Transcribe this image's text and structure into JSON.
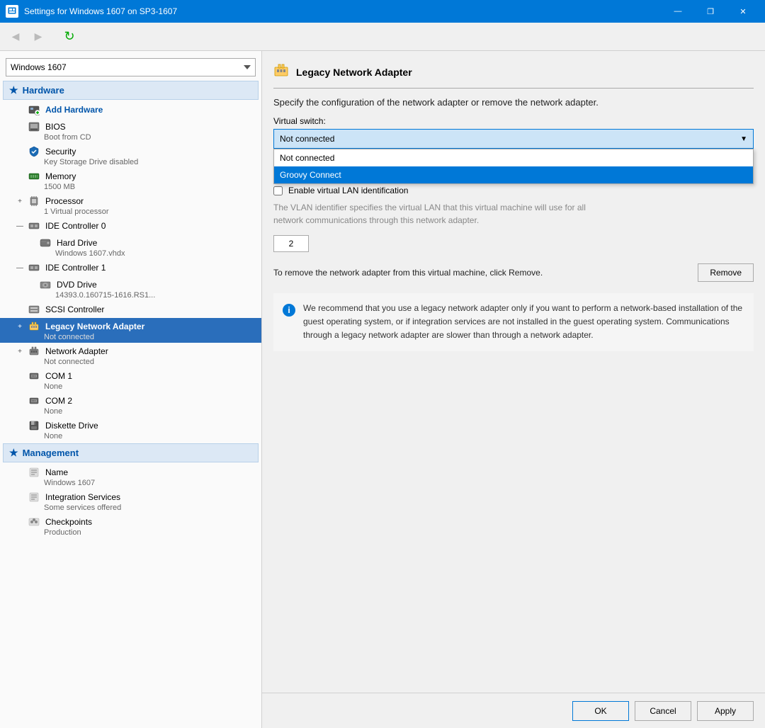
{
  "window": {
    "title": "Settings for Windows 1607 on SP3-1607",
    "icon": "⚙"
  },
  "titlebar": {
    "minimize": "—",
    "restore": "❐",
    "close": "✕"
  },
  "toolbar": {
    "back_label": "◀",
    "forward_label": "▶",
    "refresh_label": "↻"
  },
  "sidebar": {
    "dropdown_value": "Windows 1607",
    "sections": [
      {
        "id": "hardware",
        "label": "Hardware",
        "items": [
          {
            "id": "add-hardware",
            "name": "Add Hardware",
            "subtitle": "",
            "icon": "➕",
            "iconType": "add",
            "level": 1,
            "expandable": false
          },
          {
            "id": "bios",
            "name": "BIOS",
            "subtitle": "Boot from CD",
            "icon": "💾",
            "iconType": "bios",
            "level": 1,
            "expandable": false
          },
          {
            "id": "security",
            "name": "Security",
            "subtitle": "Key Storage Drive disabled",
            "icon": "🛡",
            "iconType": "security",
            "level": 1,
            "expandable": false
          },
          {
            "id": "memory",
            "name": "Memory",
            "subtitle": "1500 MB",
            "icon": "🔲",
            "iconType": "memory",
            "level": 1,
            "expandable": false
          },
          {
            "id": "processor",
            "name": "Processor",
            "subtitle": "1 Virtual processor",
            "icon": "🔲",
            "iconType": "processor",
            "level": 1,
            "expandable": true,
            "expanded": false
          },
          {
            "id": "ide0",
            "name": "IDE Controller 0",
            "subtitle": "",
            "icon": "🔲",
            "iconType": "ide",
            "level": 1,
            "expandable": true,
            "expanded": true
          },
          {
            "id": "hard-drive",
            "name": "Hard Drive",
            "subtitle": "Windows 1607.vhdx",
            "icon": "💽",
            "iconType": "harddrive",
            "level": 2,
            "expandable": false
          },
          {
            "id": "ide1",
            "name": "IDE Controller 1",
            "subtitle": "",
            "icon": "🔲",
            "iconType": "ide",
            "level": 1,
            "expandable": true,
            "expanded": true
          },
          {
            "id": "dvd",
            "name": "DVD Drive",
            "subtitle": "14393.0.160715-1616.RS1...",
            "icon": "💿",
            "iconType": "dvd",
            "level": 2,
            "expandable": false
          },
          {
            "id": "scsi",
            "name": "SCSI Controller",
            "subtitle": "",
            "icon": "⚙",
            "iconType": "scsi",
            "level": 1,
            "expandable": false
          },
          {
            "id": "legacy-net",
            "name": "Legacy Network Adapter",
            "subtitle": "Not connected",
            "icon": "🔌",
            "iconType": "network",
            "level": 1,
            "expandable": true,
            "expanded": false,
            "selected": true
          },
          {
            "id": "network-adapter",
            "name": "Network Adapter",
            "subtitle": "Not connected",
            "icon": "🖧",
            "iconType": "network2",
            "level": 1,
            "expandable": true,
            "expanded": false
          },
          {
            "id": "com1",
            "name": "COM 1",
            "subtitle": "None",
            "icon": "🔌",
            "iconType": "com",
            "level": 1,
            "expandable": false
          },
          {
            "id": "com2",
            "name": "COM 2",
            "subtitle": "None",
            "icon": "🔌",
            "iconType": "com",
            "level": 1,
            "expandable": false
          },
          {
            "id": "diskette",
            "name": "Diskette Drive",
            "subtitle": "None",
            "icon": "💾",
            "iconType": "diskette",
            "level": 1,
            "expandable": false
          }
        ]
      },
      {
        "id": "management",
        "label": "Management",
        "items": [
          {
            "id": "name",
            "name": "Name",
            "subtitle": "Windows 1607",
            "icon": "📄",
            "iconType": "name",
            "level": 1,
            "expandable": false
          },
          {
            "id": "integration",
            "name": "Integration Services",
            "subtitle": "Some services offered",
            "icon": "📄",
            "iconType": "integration",
            "level": 1,
            "expandable": false
          },
          {
            "id": "checkpoints",
            "name": "Checkpoints",
            "subtitle": "Production",
            "icon": "📷",
            "iconType": "checkpoints",
            "level": 1,
            "expandable": false
          }
        ]
      }
    ]
  },
  "panel": {
    "title": "Legacy Network Adapter",
    "icon": "🔌",
    "description": "Specify the configuration of the network adapter or remove the network adapter.",
    "virtual_switch_label": "Virtual switch:",
    "selected_switch": "Not connected",
    "dropdown_options": [
      {
        "value": "not-connected",
        "label": "Not connected"
      },
      {
        "value": "groovy-connect",
        "label": "Groovy Connect"
      }
    ],
    "enable_vlan_label": "Enable virtual LAN identification",
    "vlan_checked": false,
    "vlan_desc": "The VLAN identifier specifies the virtual LAN that this virtual machine will use for all\nnetwork communications through this network adapter.",
    "vlan_value": "2",
    "remove_desc": "To remove the network adapter from this virtual machine, click Remove.",
    "remove_btn": "Remove",
    "info_text": "We recommend that you use a legacy network adapter only if you want to perform a network-based installation of the guest operating system, or if integration services are not installed in the guest operating system. Communications through a legacy network adapter are slower than through a network adapter."
  },
  "buttons": {
    "ok": "OK",
    "cancel": "Cancel",
    "apply": "Apply"
  }
}
